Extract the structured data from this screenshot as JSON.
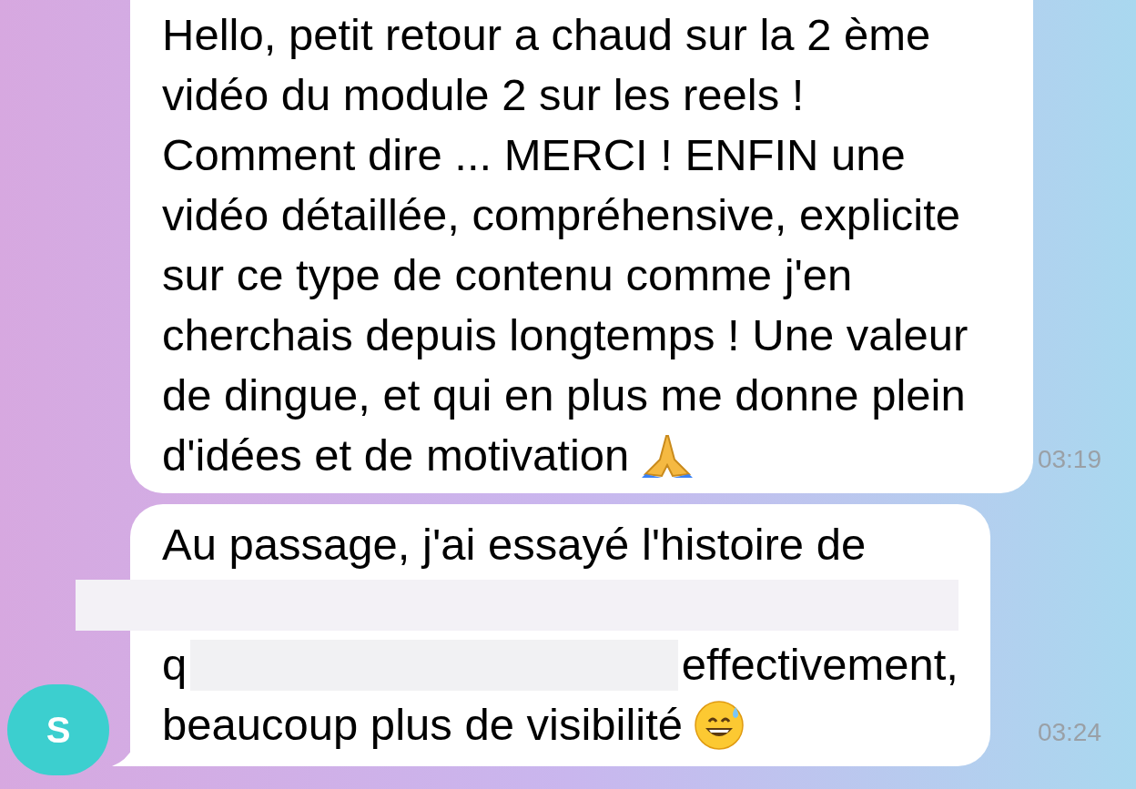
{
  "messages": [
    {
      "time": "03:19",
      "tail": false,
      "lines": [
        [
          {
            "kind": "text",
            "text": "Hello, petit retour a chaud sur la 2 ème"
          }
        ],
        [
          {
            "kind": "text",
            "text": "vidéo du module 2 sur les reels !"
          }
        ],
        [
          {
            "kind": "text",
            "text": "Comment dire ... MERCI ! ENFIN une"
          }
        ],
        [
          {
            "kind": "text",
            "text": "vidéo détaillée, compréhensive, explicite"
          }
        ],
        [
          {
            "kind": "text",
            "text": "sur ce type de contenu comme j'en"
          }
        ],
        [
          {
            "kind": "text",
            "text": "cherchais depuis longtemps ! Une valeur"
          }
        ],
        [
          {
            "kind": "text",
            "text": "de dingue, et qui en plus me donne plein"
          }
        ],
        [
          {
            "kind": "text",
            "text": "d'idées et de motivation"
          }
        ]
      ]
    },
    {
      "time": "03:24",
      "tail": true,
      "lines": [
        [
          {
            "kind": "text",
            "text": "Au passage, j'ai essayé l'histoire de"
          }
        ],
        [
          {
            "kind": "redacted"
          }
        ],
        [
          {
            "kind": "text",
            "text": "q"
          },
          {
            "kind": "redacted"
          },
          {
            "kind": "text",
            "text": "effectivement,"
          }
        ],
        [
          {
            "kind": "text",
            "text": "beaucoup plus de visibilité"
          }
        ]
      ]
    }
  ],
  "avatar": {
    "initial": "S"
  }
}
